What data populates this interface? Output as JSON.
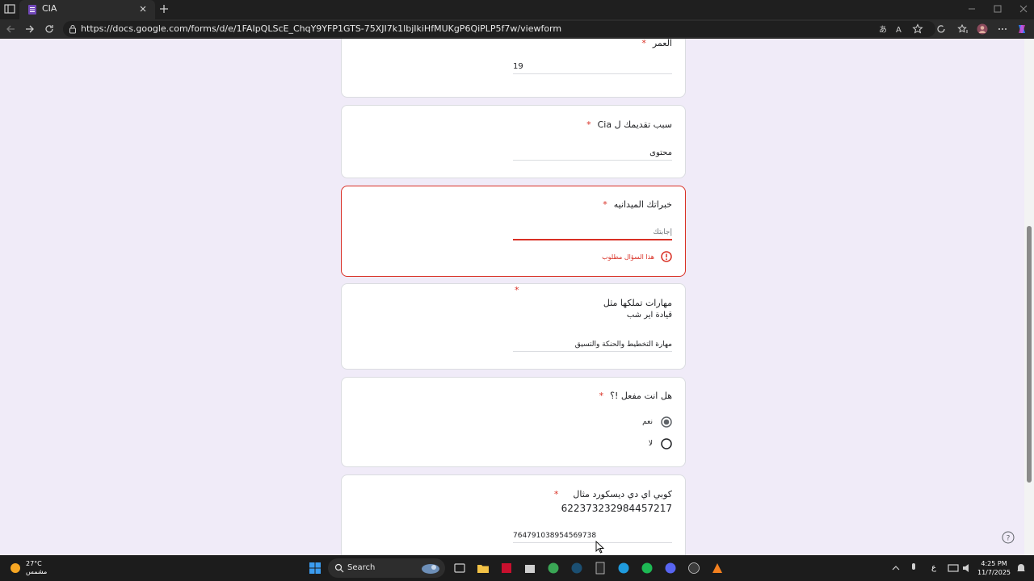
{
  "browser": {
    "tab_title": "CIA",
    "url": "https://docs.google.com/forms/d/e/1FAIpQLScE_ChqY9YFP1GTS-75XJI7k1lbjIkiHfMUKgP6QiPLP5f7w/viewform"
  },
  "form": {
    "q_age": {
      "title": "العمر",
      "required_mark": "*",
      "answer": "19"
    },
    "q_reason": {
      "title": "سبب تقديمك ل Cia",
      "required_mark": "*",
      "answer": "محتوى"
    },
    "q_experience": {
      "title": "خبراتك الميدانيه",
      "required_mark": "*",
      "placeholder": "إجابتك",
      "error": "هذا السؤال مطلوب"
    },
    "q_skills": {
      "title_line1": "مهارات تملكها مثل",
      "title_line2": "قيادة اير شب",
      "required_mark": "*",
      "answer": "مهارة التخطيط والحنكة والتسيق"
    },
    "q_active": {
      "title": "هل انت مفعل !؟",
      "required_mark": "*",
      "options": [
        {
          "label": "نعم",
          "selected": true
        },
        {
          "label": "لا",
          "selected": false
        }
      ]
    },
    "q_discord": {
      "title": "كوبي اي دي ديسكورد مثال",
      "required_mark": "*",
      "example": "622373232984457217",
      "answer": "764791038954569738"
    }
  },
  "taskbar": {
    "weather_temp": "27°C",
    "weather_desc": "مشمس",
    "search_label": "Search",
    "lang": "ع",
    "time": "4:25 PM",
    "date": "11/7/2025"
  },
  "colors": {
    "accent_error": "#d93025",
    "form_background": "#f0ebf8",
    "radio_selected": "#5f6368"
  }
}
